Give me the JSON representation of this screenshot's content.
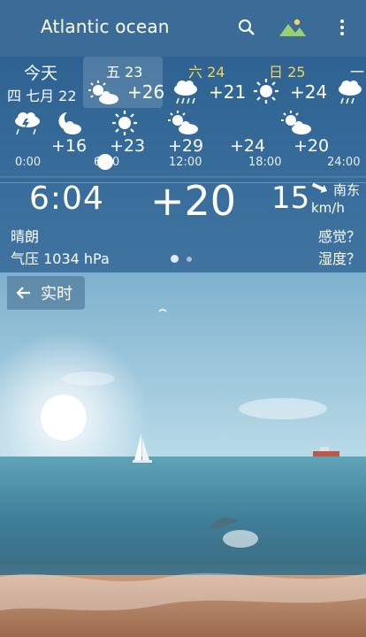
{
  "app": {
    "title": "Atlantic ocean"
  },
  "toolbar": {
    "search_icon": "search-icon",
    "wallpaper_icon": "landscape-icon",
    "menu_icon": "more-vert-icon"
  },
  "days": [
    {
      "weekday": "今天",
      "date": "四 七月 22",
      "temp": ""
    },
    {
      "weekday": "五 23",
      "temp": "+26",
      "icon": "sun-cloud-icon"
    },
    {
      "weekday": "六 24",
      "temp": "+21",
      "icon": "cloud-rain-icon",
      "color": "#f3d35b"
    },
    {
      "weekday": "日 25",
      "temp": "+24",
      "icon": "sun-icon",
      "color": "#f3d35b"
    },
    {
      "weekday": "一",
      "temp": "",
      "icon": "cloud-rain-icon"
    }
  ],
  "hours": [
    {
      "time": "0:00",
      "temp": "",
      "icon": "thunderstorm-icon"
    },
    {
      "time": "",
      "temp": "+16",
      "icon": "moon-cloud-icon"
    },
    {
      "time": "6:00",
      "temp": "+23",
      "icon": "sun-icon"
    },
    {
      "time": "12:00",
      "temp": "+29",
      "icon": "sun-cloud-icon"
    },
    {
      "time": "18:00",
      "temp": "+24",
      "icon": ""
    },
    {
      "time": "24:00",
      "temp": "+20",
      "icon": "sun-cloud-icon"
    }
  ],
  "current": {
    "time": "6:04",
    "temp": "+20",
    "wind_speed": "15",
    "wind_dir": "南东",
    "wind_unit": "km/h",
    "condition": "晴朗",
    "pressure": "气压 1034 hPa",
    "feels_like": "感觉？",
    "humidity": "湿度？"
  },
  "realtime": {
    "label": "实时"
  },
  "colors": {
    "topbar": "#3a6c97",
    "panel": "#285c8e",
    "weekend": "#f3d35b"
  }
}
